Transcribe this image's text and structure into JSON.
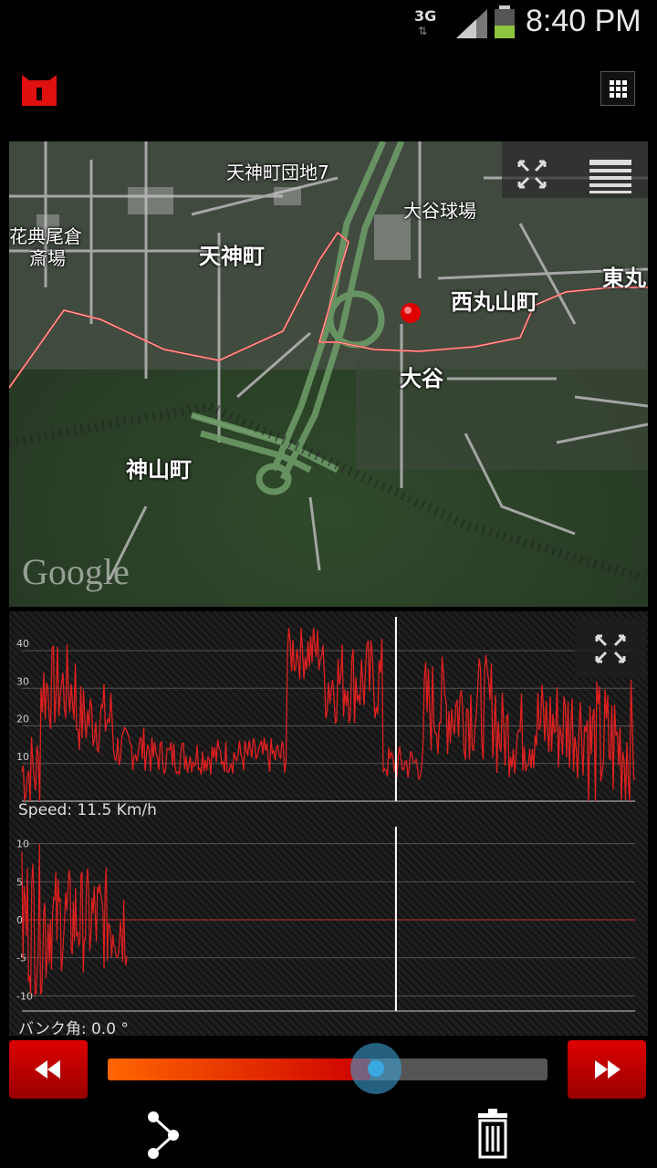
{
  "status": {
    "network": "3G",
    "time": "8:40 PM"
  },
  "map": {
    "labels": {
      "danchi": "天神町団地7",
      "stadium": "大谷球場",
      "tenjin": "天神町",
      "flower": "花典尾倉",
      "flower2": "斎場",
      "nishimaru": "西丸山町",
      "higashi": "東丸",
      "otani": "大谷",
      "kamiyama": "神山町"
    },
    "attribution": "Google"
  },
  "speed_chart": {
    "y_ticks": [
      "40",
      "30",
      "20",
      "10"
    ],
    "readout": "Speed: 11.5  Km/h"
  },
  "bank_chart": {
    "y_ticks": [
      "10",
      "5",
      "0",
      "-5",
      "-10"
    ],
    "readout": "バンク角: 0.0 °"
  },
  "playback": {
    "position_fraction": 0.61
  },
  "icons": {
    "rewind": "rewind-icon",
    "forward": "fast-forward-icon",
    "share": "share-icon",
    "delete": "trash-icon",
    "grid": "grid-menu-icon",
    "expand": "expand-icon",
    "layers": "map-layers-icon"
  }
}
